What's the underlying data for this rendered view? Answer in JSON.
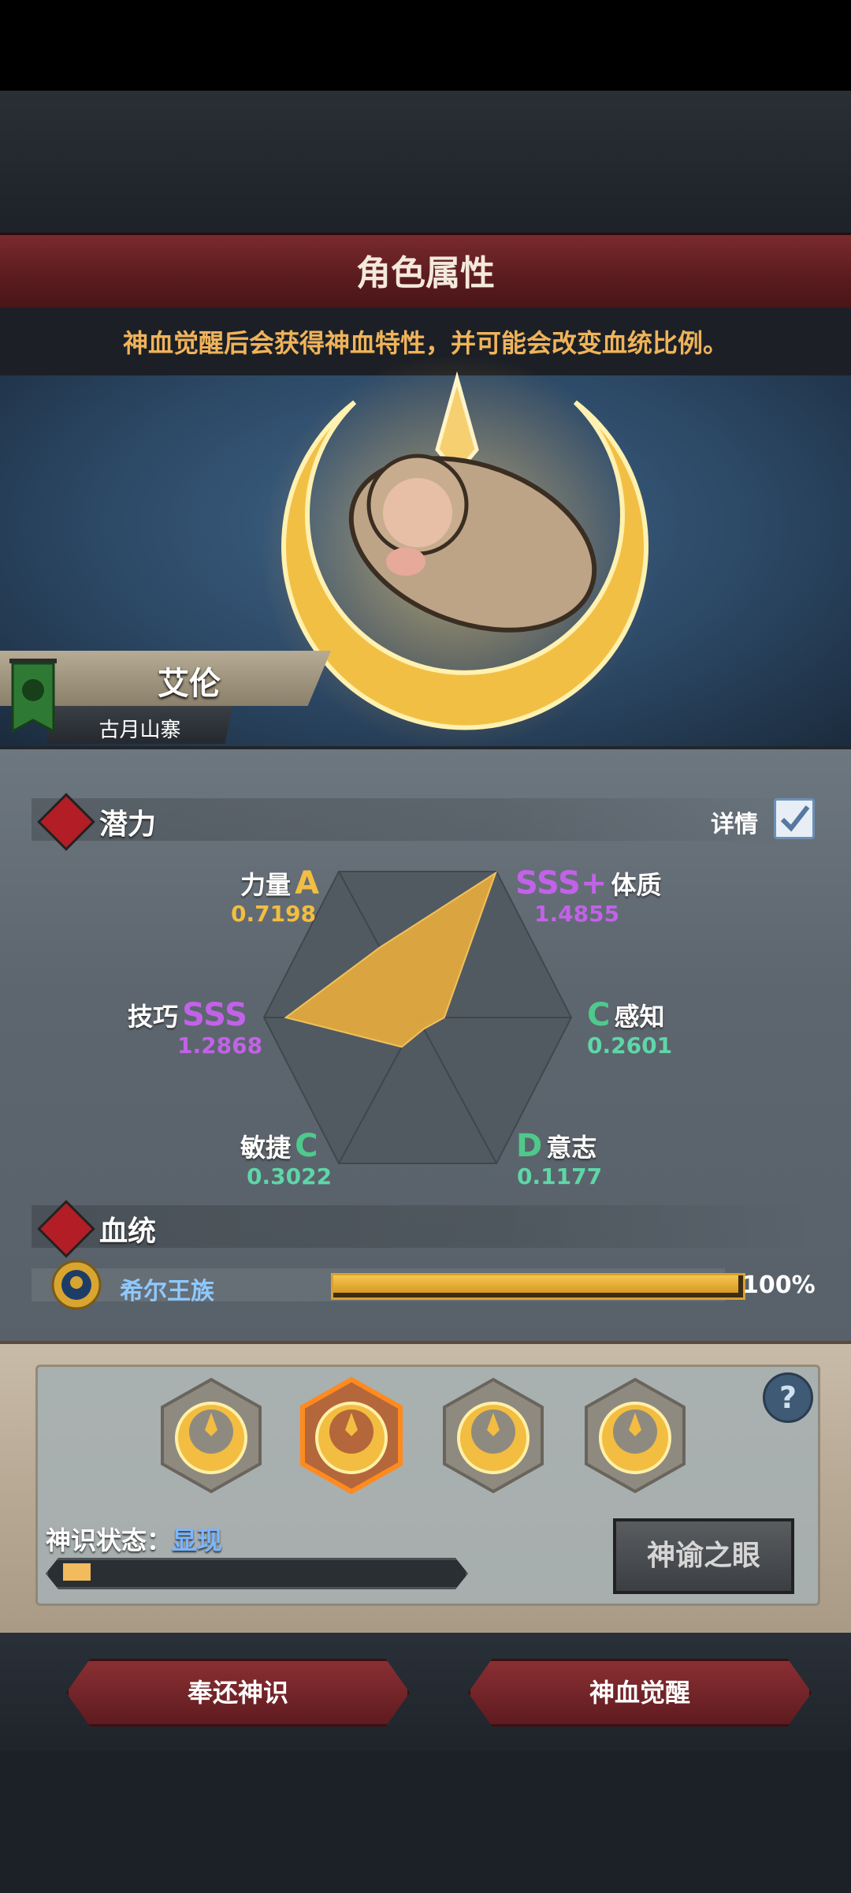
{
  "header": {
    "title": "角色属性",
    "notice": "神血觉醒后会获得神血特性，并可能会改变血统比例。"
  },
  "character": {
    "name": "艾伦",
    "origin": "古月山寨"
  },
  "potential": {
    "label": "潜力",
    "detail_label": "详情",
    "detail_checked": true
  },
  "stats": [
    {
      "name": "力量",
      "grade": "A",
      "value": "0.7198"
    },
    {
      "name": "体质",
      "grade": "SSS+",
      "value": "1.4855"
    },
    {
      "name": "感知",
      "grade": "C",
      "value": "0.2601"
    },
    {
      "name": "意志",
      "grade": "D",
      "value": "0.1177"
    },
    {
      "name": "敏捷",
      "grade": "C",
      "value": "0.3022"
    },
    {
      "name": "技巧",
      "grade": "SSS",
      "value": "1.2868"
    }
  ],
  "lineage": {
    "label": "血统",
    "name": "希尔王族",
    "percent": "100%",
    "fraction": 1.0
  },
  "awakening": {
    "status_label": "神识状态：",
    "status_value": "显现",
    "progress": 0.07,
    "oracle_button": "神谕之眼",
    "selected_slot": 1
  },
  "footer": {
    "return_button": "奉还神识",
    "awaken_button": "神血觉醒"
  },
  "colors": {
    "accent_gold": "#f2bd41",
    "grade_purple": "#c262e8",
    "grade_green": "#4fc98b",
    "banner_red": "#7a2a2c"
  }
}
